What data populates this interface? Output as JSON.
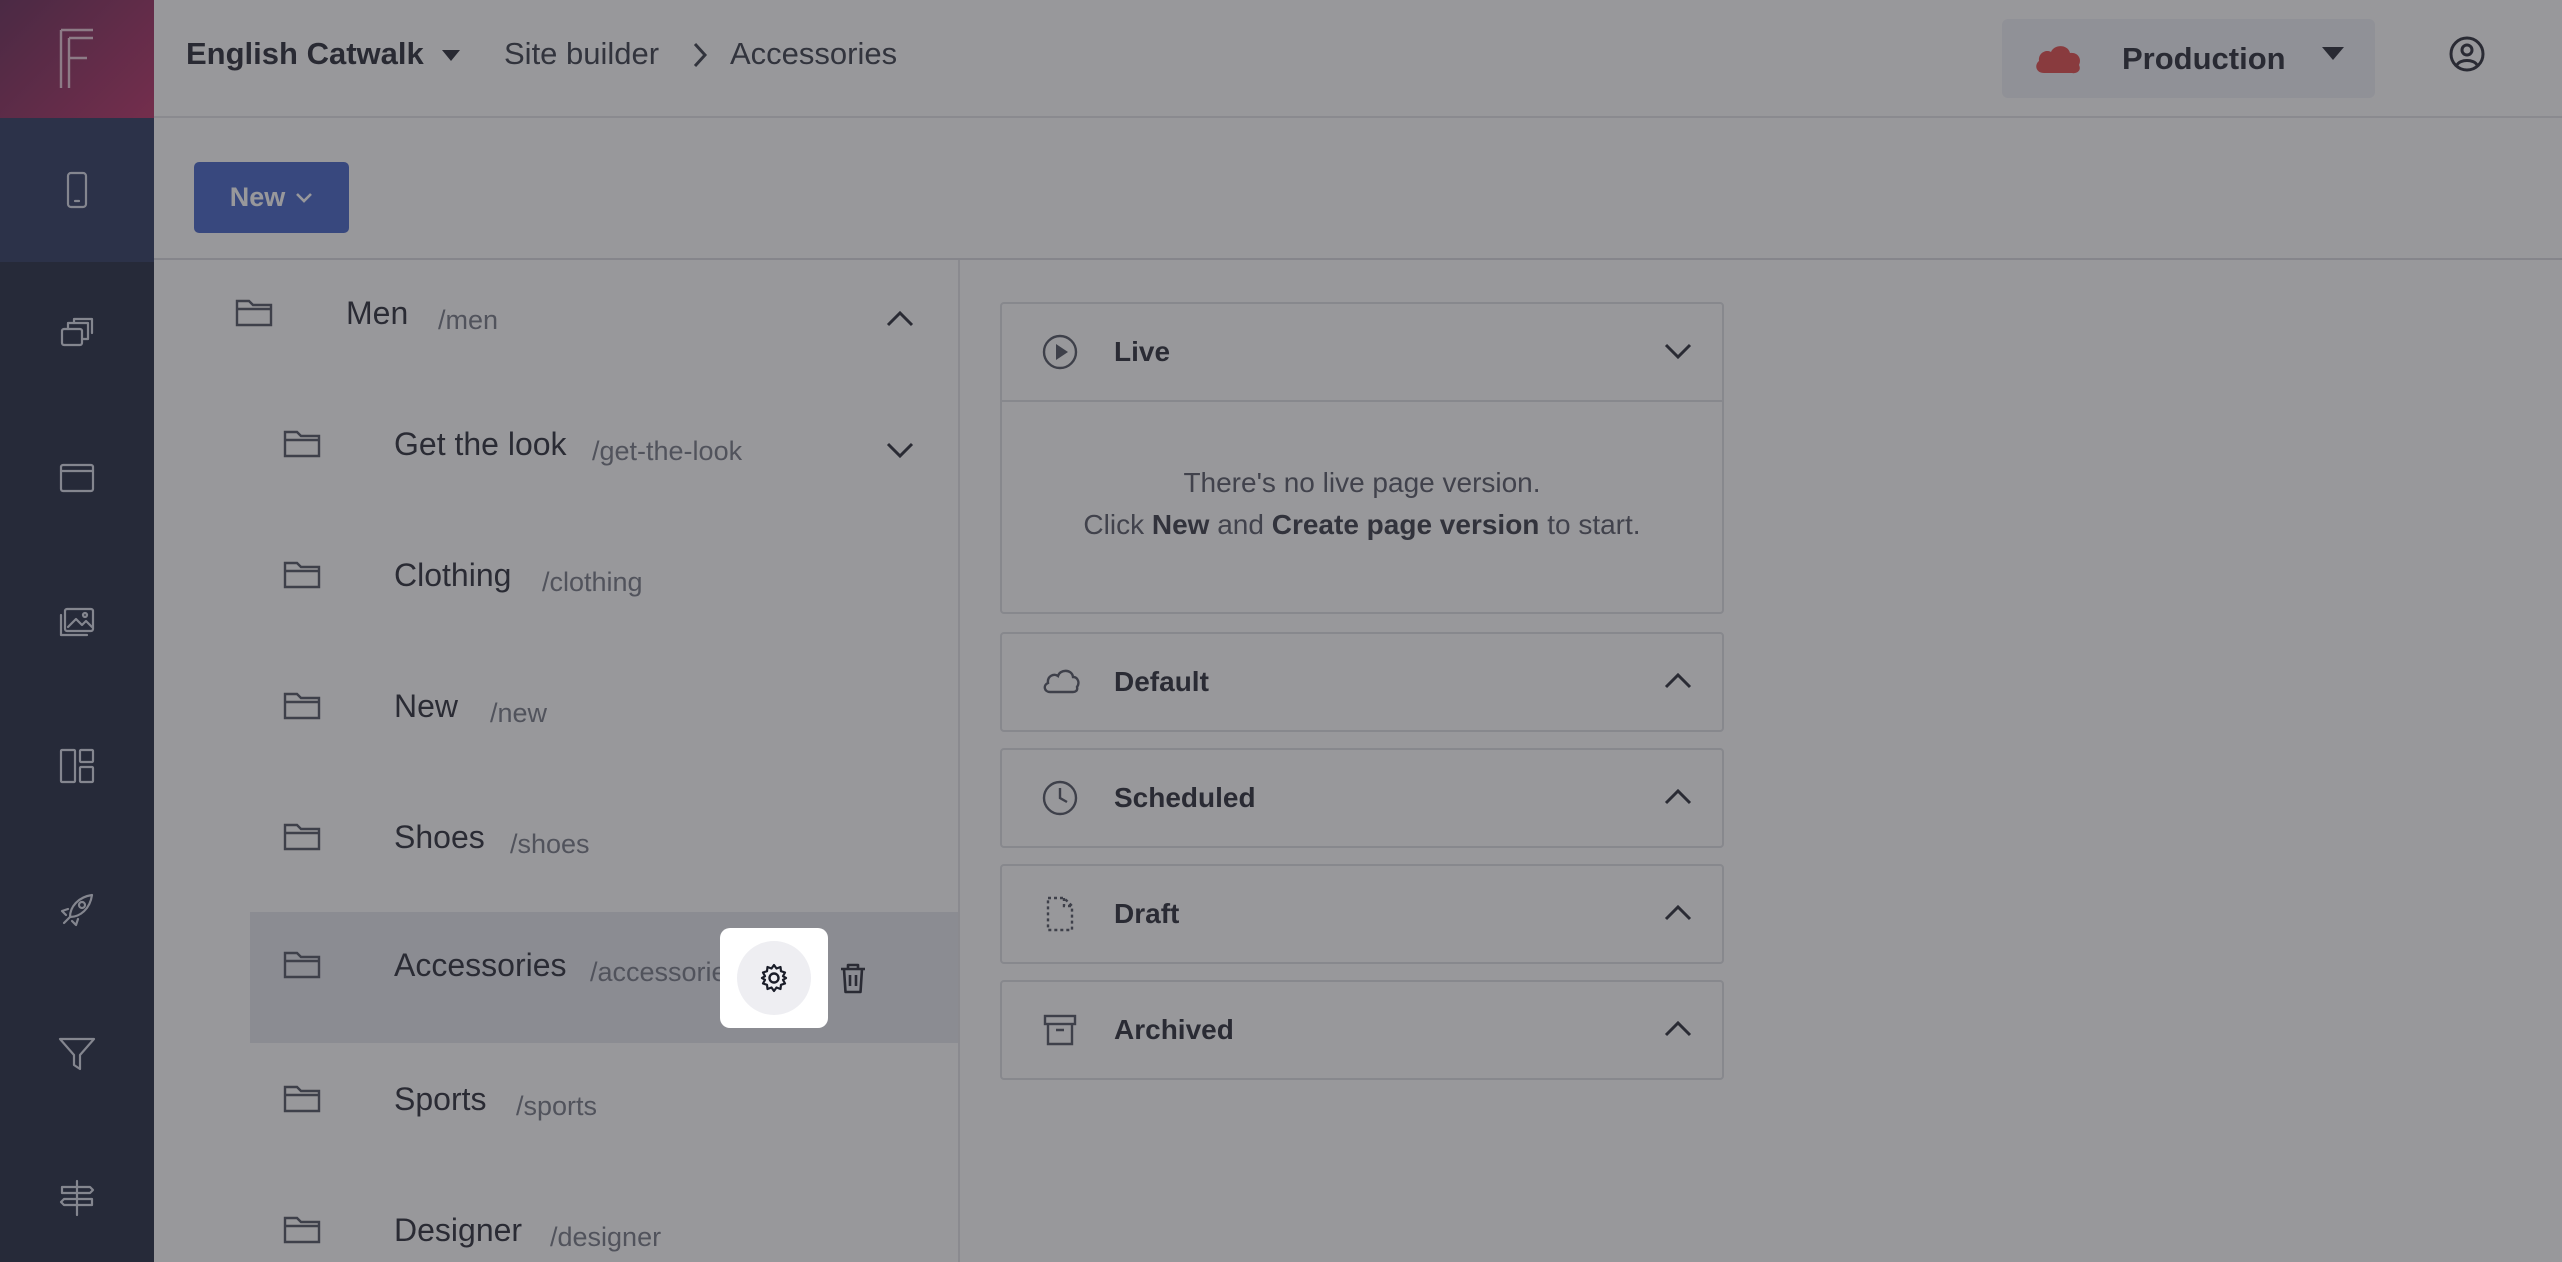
{
  "app": {
    "logo_letter": "F"
  },
  "rail": {
    "items": [
      {
        "icon": "mobile-icon",
        "active": true
      },
      {
        "icon": "content-stack-icon"
      },
      {
        "icon": "browser-window-icon"
      },
      {
        "icon": "media-library-icon"
      },
      {
        "icon": "dashboard-layout-icon"
      },
      {
        "icon": "rocket-icon"
      },
      {
        "icon": "filter-icon"
      },
      {
        "icon": "signpost-icon"
      }
    ]
  },
  "header": {
    "project": "English Catwalk",
    "breadcrumb": [
      "Site builder",
      "Accessories"
    ],
    "environment": "Production",
    "environment_color": "#e03e3e"
  },
  "toolbar": {
    "new_label": "New"
  },
  "tree": {
    "rows": [
      {
        "name": "Men",
        "slug": "/men",
        "expanded": true
      },
      {
        "name": "Get the look",
        "slug": "/get-the-look",
        "expanded": false
      },
      {
        "name": "Clothing",
        "slug": "/clothing"
      },
      {
        "name": "New",
        "slug": "/new"
      },
      {
        "name": "Shoes",
        "slug": "/shoes"
      },
      {
        "name": "Accessories",
        "slug": "/accessories",
        "selected": true
      },
      {
        "name": "Sports",
        "slug": "/sports"
      },
      {
        "name": "Designer",
        "slug": "/designer"
      }
    ]
  },
  "versions": {
    "live": {
      "title": "Live",
      "message_line1": "There's no live page version.",
      "message_click": "Click",
      "message_new": "New",
      "message_and": "and",
      "message_create": "Create page version",
      "message_end": "to start."
    },
    "sections": [
      {
        "title": "Default",
        "icon": "cloud-icon"
      },
      {
        "title": "Scheduled",
        "icon": "clock-icon"
      },
      {
        "title": "Draft",
        "icon": "draft-document-icon"
      },
      {
        "title": "Archived",
        "icon": "archive-box-icon"
      }
    ]
  },
  "colors": {
    "rail_bg": "#111a33",
    "accent": "#3858c2",
    "logo_gradient": [
      "#5e1a4a",
      "#b3225c"
    ]
  }
}
